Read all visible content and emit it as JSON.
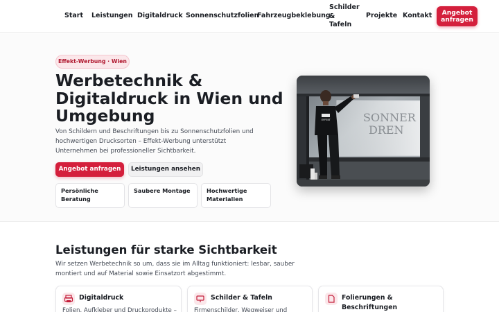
{
  "nav": {
    "items": [
      "Start",
      "Leistungen",
      "Digitaldruck",
      "Sonnenschutzfolien",
      "Fahrzeugbeklebung",
      "Schilder & Tafeln",
      "Projekte",
      "Kontakt"
    ],
    "schilder_lines": [
      "Schilder",
      "&",
      "Tafeln"
    ],
    "cta_lines": [
      "Angebot",
      "anfragen"
    ]
  },
  "hero": {
    "badge": "Effekt-Werbung · Wien",
    "title": "Werbetechnik & Digitaldruck in Wien und Umgebung",
    "lead": "Von Schildern und Beschriftungen bis zu Sonnenschutzfolien und hochwertigen Drucksorten – Effekt-Werbung unterstützt Unternehmen bei professioneller Sichtbarkeit.",
    "primary_cta": "Angebot anfragen",
    "secondary_cta": "Leistungen ansehen",
    "features": [
      "Persönliche Beratung",
      "Saubere Montage",
      "Hochwertige Materialien"
    ],
    "photo": {
      "window_text_lines": [
        "SONNER",
        "DREN"
      ],
      "shirt_text": "EFFEKT"
    }
  },
  "services": {
    "title": "Leistungen für starke Sichtbarkeit",
    "subtitle": "Wir setzen Werbetechnik so um, dass sie im Alltag funktioniert: lesbar, sauber montiert und auf Material sowie Einsatzort abgestimmt.",
    "cards": [
      {
        "icon": "printer-icon",
        "title": "Digitaldruck",
        "description": "Folien, Aufkleber und Druckprodukte –"
      },
      {
        "icon": "sign-icon",
        "title": "Schilder & Tafeln",
        "description": "Firmenschilder, Wegweiser und"
      },
      {
        "icon": "document-icon",
        "title": "Folierungen & Beschriftungen",
        "description": ""
      }
    ]
  },
  "colors": {
    "accent": "#d41f3c",
    "badge_bg": "#fbe7ea",
    "text": "#1a1d23",
    "muted": "#444a55"
  }
}
